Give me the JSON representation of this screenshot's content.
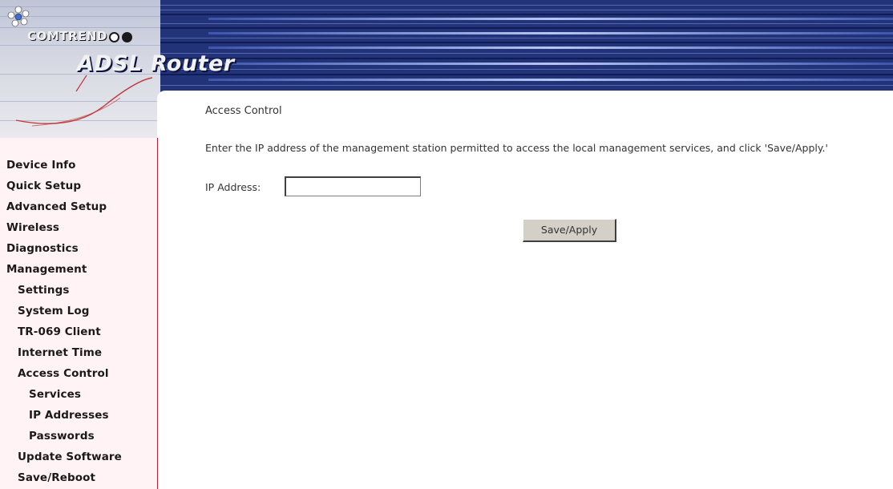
{
  "header": {
    "brand": "COMTREND",
    "product_title": "ADSL Router"
  },
  "sidebar": {
    "items": [
      {
        "label": "Device Info",
        "level": 1
      },
      {
        "label": "Quick Setup",
        "level": 1
      },
      {
        "label": "Advanced Setup",
        "level": 1
      },
      {
        "label": "Wireless",
        "level": 1
      },
      {
        "label": "Diagnostics",
        "level": 1
      },
      {
        "label": "Management",
        "level": 1
      },
      {
        "label": "Settings",
        "level": 2
      },
      {
        "label": "System Log",
        "level": 2
      },
      {
        "label": "TR-069 Client",
        "level": 2
      },
      {
        "label": "Internet Time",
        "level": 2
      },
      {
        "label": "Access Control",
        "level": 2
      },
      {
        "label": "Services",
        "level": 3
      },
      {
        "label": "IP Addresses",
        "level": 3
      },
      {
        "label": "Passwords",
        "level": 3
      },
      {
        "label": "Update Software",
        "level": 2
      },
      {
        "label": "Save/Reboot",
        "level": 2
      }
    ]
  },
  "main": {
    "title": "Access Control",
    "instructions": "Enter the IP address of the management station permitted to access the local management services, and click 'Save/Apply.'",
    "ip_label": "IP Address:",
    "ip_value": "",
    "save_button": "Save/Apply"
  },
  "colors": {
    "banner": "#23337a",
    "sidebar_bg": "#fff3f5",
    "sidebar_border": "#b21f37"
  }
}
